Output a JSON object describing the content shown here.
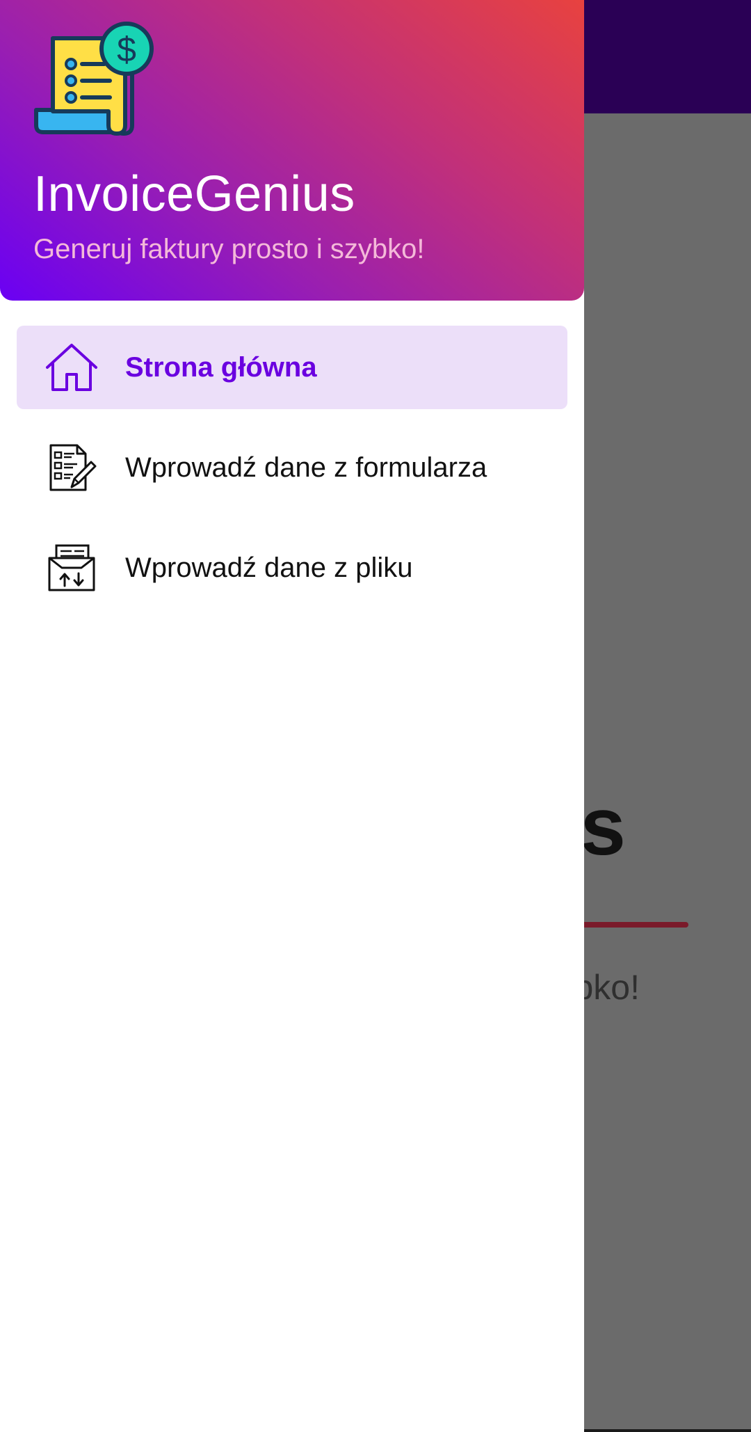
{
  "background": {
    "title_fragment": "us",
    "subtitle_fragment": "bko!",
    "appbar_color": "#2a0055",
    "accent_line_color": "#7a1a2a"
  },
  "drawer": {
    "header": {
      "logo_icon": "invoice-dollar-icon",
      "app_name": "InvoiceGenius",
      "tagline": "Generuj faktury prosto i szybko!",
      "gradient": [
        "#6a00f4",
        "#e8423f"
      ]
    },
    "items": [
      {
        "label": "Strona główna",
        "icon": "home-icon",
        "active": true
      },
      {
        "label": "Wprowadź dane z formularza",
        "icon": "form-edit-icon",
        "active": false
      },
      {
        "label": "Wprowadź dane z pliku",
        "icon": "file-upload-download-icon",
        "active": false
      }
    ],
    "active_color": "#6a00e0",
    "active_background": "#ecdff9"
  }
}
